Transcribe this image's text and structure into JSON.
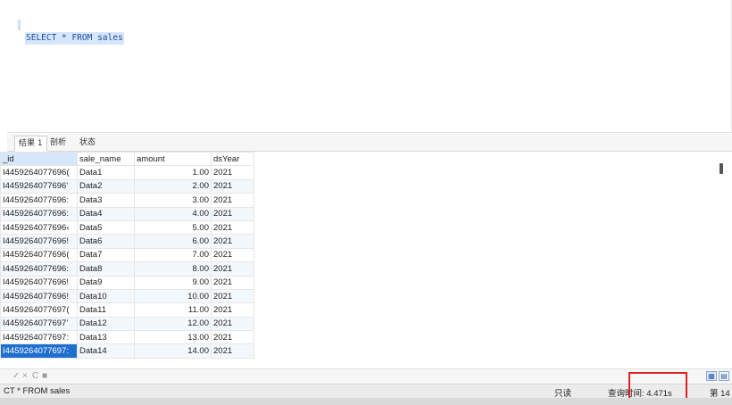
{
  "editor": {
    "sql": "SELECT * FROM sales"
  },
  "result_tabs": [
    {
      "label": "结果 1",
      "active": true
    },
    {
      "label": "剖析",
      "active": false
    },
    {
      "label": "状态",
      "active": false
    }
  ],
  "grid": {
    "columns": [
      "_id",
      "sale_name",
      "amount",
      "dsYear"
    ],
    "rows": [
      [
        "I4459264077696(",
        "Data1",
        "1.00",
        "2021"
      ],
      [
        "I4459264077696'",
        "Data2",
        "2.00",
        "2021"
      ],
      [
        "I4459264077696:",
        "Data3",
        "3.00",
        "2021"
      ],
      [
        "I4459264077696:",
        "Data4",
        "4.00",
        "2021"
      ],
      [
        "I4459264077696‹",
        "Data5",
        "5.00",
        "2021"
      ],
      [
        "I4459264077696!",
        "Data6",
        "6.00",
        "2021"
      ],
      [
        "I4459264077696(",
        "Data7",
        "7.00",
        "2021"
      ],
      [
        "I4459264077696:",
        "Data8",
        "8.00",
        "2021"
      ],
      [
        "I4459264077696!",
        "Data9",
        "9.00",
        "2021"
      ],
      [
        "I4459264077696!",
        "Data10",
        "10.00",
        "2021"
      ],
      [
        "I4459264077697(",
        "Data11",
        "11.00",
        "2021"
      ],
      [
        "I4459264077697'",
        "Data12",
        "12.00",
        "2021"
      ],
      [
        "I4459264077697:",
        "Data13",
        "13.00",
        "2021"
      ],
      [
        "I4459264077697:",
        "Data14",
        "14.00",
        "2021"
      ]
    ],
    "selected_row": 13
  },
  "toolbar_icons": [
    "check-icon",
    "cross-icon",
    "refresh-icon",
    "stop-icon"
  ],
  "toolbar_glyphs": [
    "✓",
    "×",
    "C",
    "■"
  ],
  "view_buttons": [
    {
      "name": "grid-view-icon",
      "glyph": "▦",
      "active": true
    },
    {
      "name": "form-view-icon",
      "glyph": "▤",
      "active": false
    }
  ],
  "status": {
    "query": "CT * FROM sales",
    "mode": "只读",
    "query_time": "查询时间: 4.471s",
    "page": "第 14"
  },
  "colors": {
    "selection": "#1f6fd0",
    "highlight_box": "#e02020",
    "sql_text": "#1a4f9c"
  }
}
